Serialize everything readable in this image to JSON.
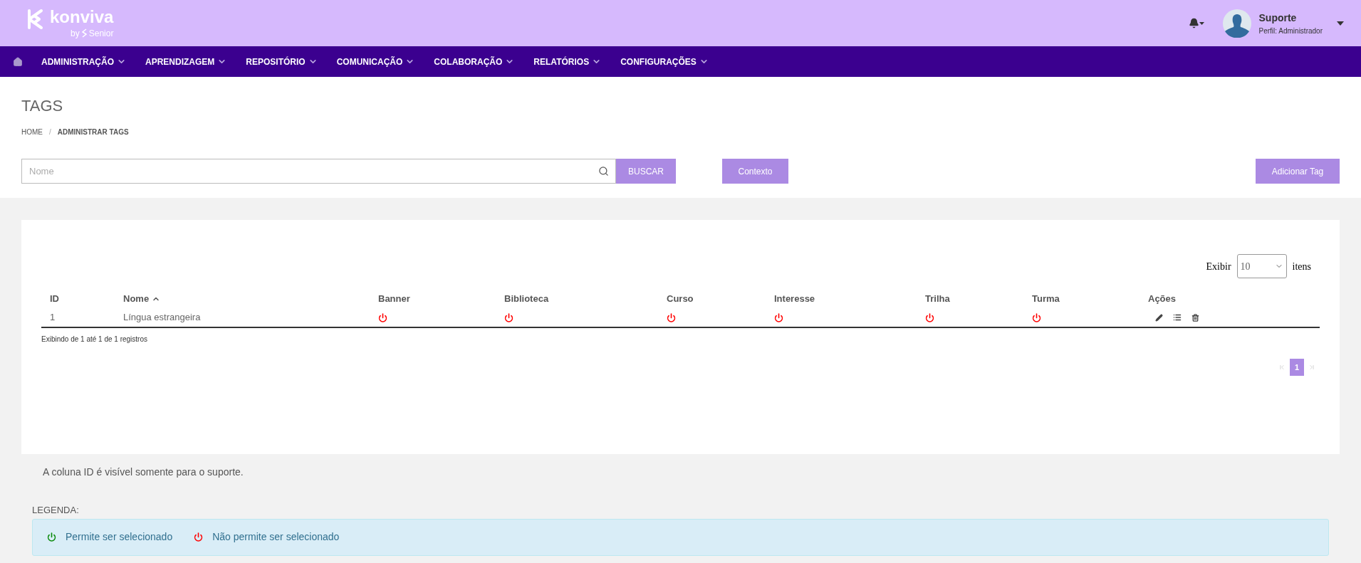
{
  "header": {
    "logo": {
      "name": "konviva",
      "by": "by",
      "company": "Senior"
    },
    "user": {
      "name": "Suporte",
      "profile": "Perfil: Administrador"
    }
  },
  "nav": {
    "items": [
      {
        "label": "ADMINISTRAÇÃO"
      },
      {
        "label": "APRENDIZAGEM"
      },
      {
        "label": "REPOSITÓRIO"
      },
      {
        "label": "COMUNICAÇÃO"
      },
      {
        "label": "COLABORAÇÃO"
      },
      {
        "label": "RELATÓRIOS"
      },
      {
        "label": "CONFIGURAÇÕES"
      }
    ]
  },
  "page": {
    "title": "TAGS",
    "breadcrumb": [
      "HOME",
      "/",
      "ADMINISTRAR TAGS"
    ]
  },
  "toolbar": {
    "search": {
      "placeholder": "Nome"
    },
    "search_button": "BUSCAR",
    "context_button": "Contexto",
    "add_button": "Adicionar Tag"
  },
  "table": {
    "page_size": {
      "label": "Exibir",
      "value": "10",
      "suffix": "itens"
    },
    "columns": [
      {
        "label": "ID",
        "sorted": false
      },
      {
        "label": "Nome",
        "sorted": true
      },
      {
        "label": "Banner",
        "sorted": false
      },
      {
        "label": "Biblioteca",
        "sorted": false
      },
      {
        "label": "Curso",
        "sorted": false
      },
      {
        "label": "Interesse",
        "sorted": false
      },
      {
        "label": "Trilha",
        "sorted": false
      },
      {
        "label": "Turma",
        "sorted": false
      },
      {
        "label": "Ações",
        "sorted": false
      }
    ],
    "rows": [
      {
        "id": "1",
        "name": "Língua estrangeira",
        "flags": [
          false,
          false,
          false,
          false,
          false,
          false
        ]
      }
    ],
    "info": "Exibindo de 1 até 1 de 1 registros",
    "pages": [
      {
        "label": "1",
        "selected": true
      }
    ]
  },
  "note": "A coluna ID é visível somente para o suporte.",
  "legend": {
    "title": "LEGENDA:",
    "items": [
      {
        "allowed": true,
        "label": "Permite ser selecionado"
      },
      {
        "allowed": false,
        "label": "Não permite ser selecionado"
      }
    ]
  }
}
